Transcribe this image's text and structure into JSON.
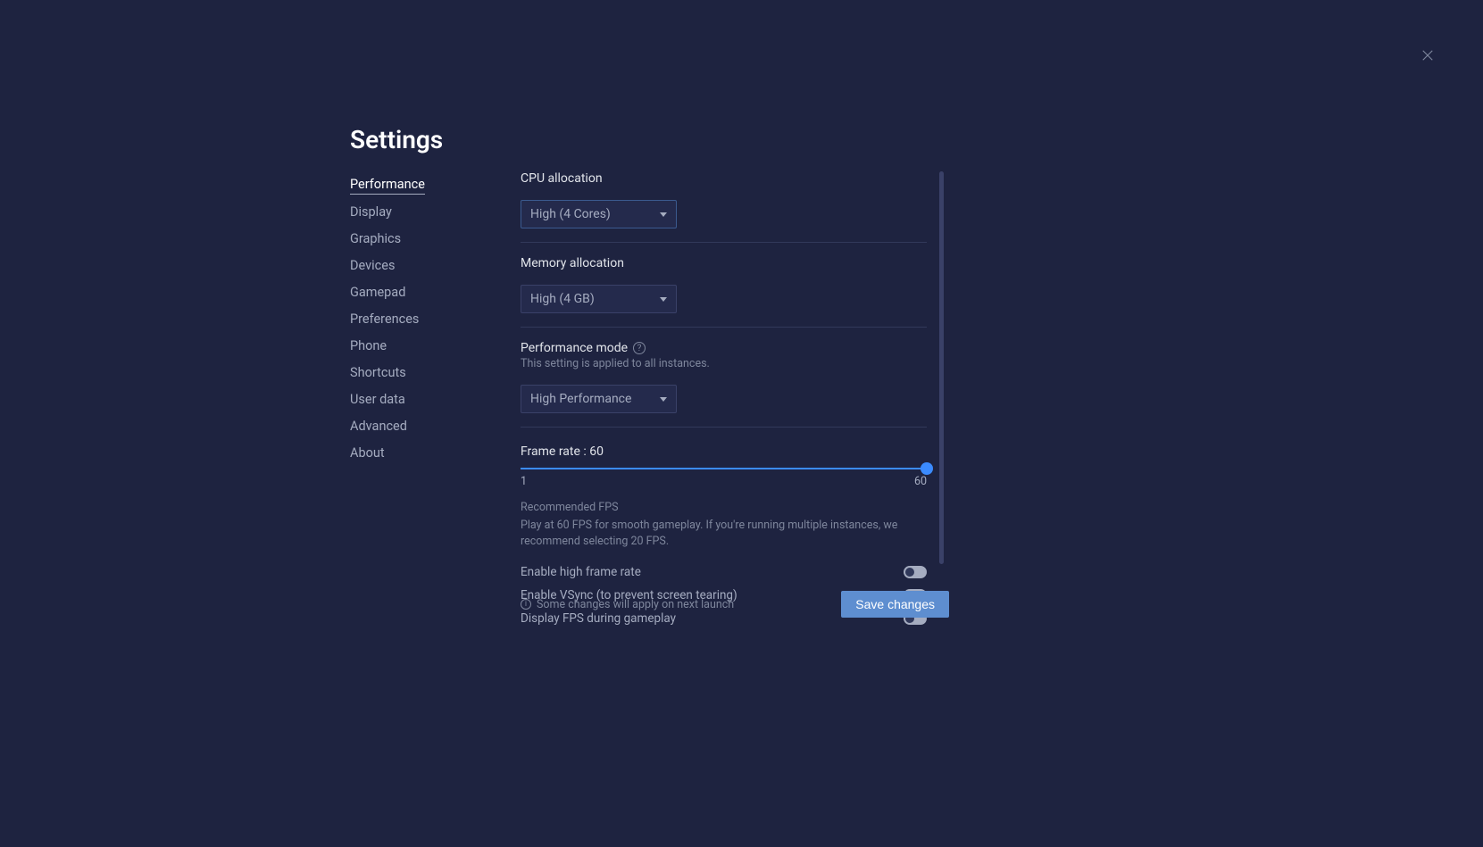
{
  "title": "Settings",
  "sidebar": {
    "items": [
      {
        "label": "Performance",
        "active": true
      },
      {
        "label": "Display"
      },
      {
        "label": "Graphics"
      },
      {
        "label": "Devices"
      },
      {
        "label": "Gamepad"
      },
      {
        "label": "Preferences"
      },
      {
        "label": "Phone"
      },
      {
        "label": "Shortcuts"
      },
      {
        "label": "User data"
      },
      {
        "label": "Advanced"
      },
      {
        "label": "About"
      }
    ]
  },
  "cpu": {
    "label": "CPU allocation",
    "value": "High (4 Cores)"
  },
  "memory": {
    "label": "Memory allocation",
    "value": "High (4 GB)"
  },
  "perfmode": {
    "label": "Performance mode",
    "sublabel": "This setting is applied to all instances.",
    "value": "High Performance"
  },
  "framerate": {
    "label_prefix": "Frame rate : ",
    "value": "60",
    "min": "1",
    "max": "60",
    "reco_title": "Recommended FPS",
    "reco_body": "Play at 60 FPS for smooth gameplay. If you're running multiple instances, we recommend selecting 20 FPS."
  },
  "toggles": {
    "high_fps": "Enable high frame rate",
    "vsync": "Enable VSync (to prevent screen tearing)",
    "display_fps": "Display FPS during gameplay"
  },
  "footer": {
    "note": "Some changes will apply on next launch",
    "save": "Save changes"
  }
}
